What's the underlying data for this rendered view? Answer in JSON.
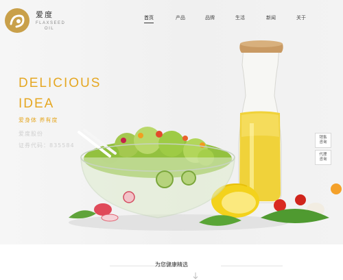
{
  "header": {
    "brand_cn": "爱度",
    "brand_en": "FLAXSEED OIL",
    "nav": [
      {
        "label": "首页",
        "active": true
      },
      {
        "label": "产品",
        "active": false
      },
      {
        "label": "品牌",
        "active": false
      },
      {
        "label": "生活",
        "active": false
      },
      {
        "label": "新闻",
        "active": false
      },
      {
        "label": "关于",
        "active": false
      }
    ]
  },
  "hero": {
    "title_line1": "DELICIOUS",
    "title_line2": "IDEA",
    "subtitle": "爱身体 养有度",
    "company": "爱度股份",
    "stock_code": "证券代码：835584"
  },
  "side_buttons": [
    {
      "label_line1": "销售",
      "label_line2": "咨询"
    },
    {
      "label_line1": "代理",
      "label_line2": "咨询"
    }
  ],
  "section": {
    "title": "为您健康精选"
  },
  "colors": {
    "accent": "#e5a722",
    "logo_gold": "#c9a04a",
    "text_dark": "#333333",
    "muted": "#cfcfcf"
  },
  "icons": [
    "logo-icon",
    "scroll-down-icon"
  ]
}
